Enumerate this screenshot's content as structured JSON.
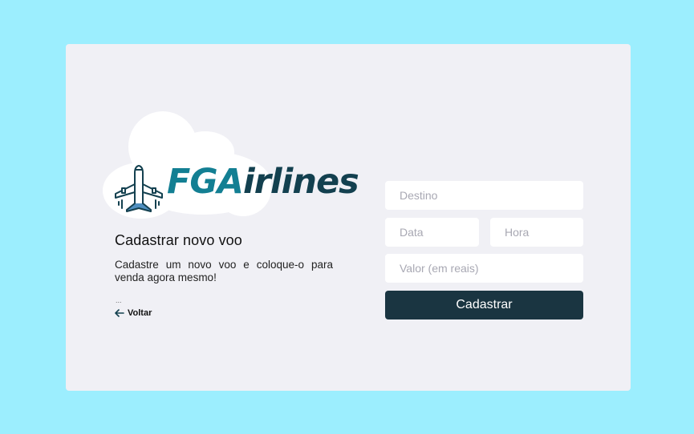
{
  "logo": {
    "brand_prefix": "FGA",
    "brand_suffix": "irlines",
    "icon": "airplane-icon",
    "colors": {
      "prefix": "#137f93",
      "suffix": "#13404f",
      "cloud": "#ffffff"
    }
  },
  "intro": {
    "title": "Cadastrar novo voo",
    "description": "Cadastre um novo voo e coloque-o para venda agora mesmo!",
    "dots": "...",
    "back_label": "Voltar",
    "back_icon": "arrow-left-icon"
  },
  "form": {
    "destino_placeholder": "Destino",
    "data_placeholder": "Data",
    "hora_placeholder": "Hora",
    "valor_placeholder": "Valor (em reais)",
    "submit_label": "Cadastrar"
  },
  "colors": {
    "background": "#9ceefe",
    "card": "#f0f0f5",
    "button": "#1a3541",
    "input": "#ffffff"
  }
}
